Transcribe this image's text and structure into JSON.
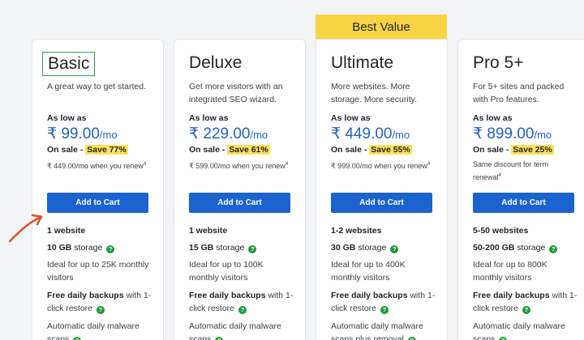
{
  "badge": "Best Value",
  "plans": [
    {
      "name": "Basic",
      "description": "A great way to get started.",
      "as_low_as": "As low as",
      "price": "₹ 99.00",
      "per": "/mo",
      "on_sale": "On sale -",
      "save": "Save 77%",
      "renew": "₹ 449.00/mo when you renew",
      "renew_note": "4",
      "cta": "Add to Cart",
      "websites": "1 website",
      "storage_value": "10 GB",
      "storage_label": "storage",
      "ideal": "Ideal for up to 25K monthly visitors",
      "backup_bold": "Free daily backups",
      "backup_rest": "with 1-click restore",
      "malware": "Automatic daily malware scans"
    },
    {
      "name": "Deluxe",
      "description": "Get more visitors with an integrated SEO wizard.",
      "as_low_as": "As low as",
      "price": "₹ 229.00",
      "per": "/mo",
      "on_sale": "On sale -",
      "save": "Save 61%",
      "renew": "₹ 599.00/mo when you renew",
      "renew_note": "4",
      "cta": "Add to Cart",
      "websites": "1 website",
      "storage_value": "15 GB",
      "storage_label": "storage",
      "ideal": "Ideal for up to 100K monthly visitors",
      "backup_bold": "Free daily backups",
      "backup_rest": "with 1-click restore",
      "malware": "Automatic daily malware scans"
    },
    {
      "name": "Ultimate",
      "description": "More websites. More storage. More security.",
      "as_low_as": "As low as",
      "price": "₹ 449.00",
      "per": "/mo",
      "on_sale": "On sale -",
      "save": "Save 55%",
      "renew": "₹ 999.00/mo when you renew",
      "renew_note": "4",
      "cta": "Add to Cart",
      "websites": "1-2 websites",
      "storage_value": "30 GB",
      "storage_label": "storage",
      "ideal": "Ideal for up to 400K monthly visitors",
      "backup_bold": "Free daily backups",
      "backup_rest": "with 1-click restore",
      "malware": "Automatic daily malware scans plus removal"
    },
    {
      "name": "Pro 5+",
      "description": "For 5+ sites and packed with Pro features.",
      "as_low_as": "As low as",
      "price": "₹ 899.00",
      "per": "/mo",
      "on_sale": "On sale -",
      "save": "Save 25%",
      "renew": "Same discount for term renewal",
      "renew_note": "4",
      "cta": "Add to Cart",
      "websites": "5-50 websites",
      "storage_value": "50-200 GB",
      "storage_label": "storage",
      "ideal": "Ideal for up to 800K monthly visitors",
      "backup_bold": "Free daily backups",
      "backup_rest": "with 1-click restore",
      "malware": "Automatic daily malware scans"
    }
  ],
  "help_icon_glyph": "?",
  "colors": {
    "accent": "#1b63d1",
    "price": "#2161c7",
    "badge": "#f8d443",
    "highlight": "#fbe15a",
    "help_icon": "#1f9a3a",
    "annotation_box": "#2fa34a",
    "annotation_arrow": "#e2522a"
  }
}
